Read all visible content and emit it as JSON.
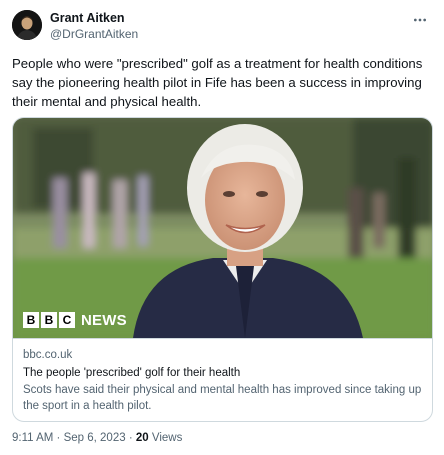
{
  "author": {
    "name": "Grant Aitken",
    "handle": "@DrGrantAitken"
  },
  "icons": {
    "more": "more-horizontal-icon",
    "avatar": "profile-photo"
  },
  "tweet": {
    "text": "People who were \"prescribed\" golf as a treatment for health conditions say the pioneering health pilot in Fife has been a success in improving their mental and physical health."
  },
  "card": {
    "logo_letters": [
      "B",
      "B",
      "C"
    ],
    "logo_word": "NEWS",
    "domain": "bbc.co.uk",
    "title": "The people 'prescribed' golf for their health",
    "description": "Scots have said their physical and mental health has improved since taking up the sport in a health pilot."
  },
  "meta": {
    "time": "9:11 AM",
    "separator": "·",
    "date": "Sep 6, 2023",
    "views_count": "20",
    "views_label": "Views"
  },
  "colors": {
    "primary_text": "#0f1419",
    "secondary_text": "#536471",
    "border": "#cfd9de"
  }
}
